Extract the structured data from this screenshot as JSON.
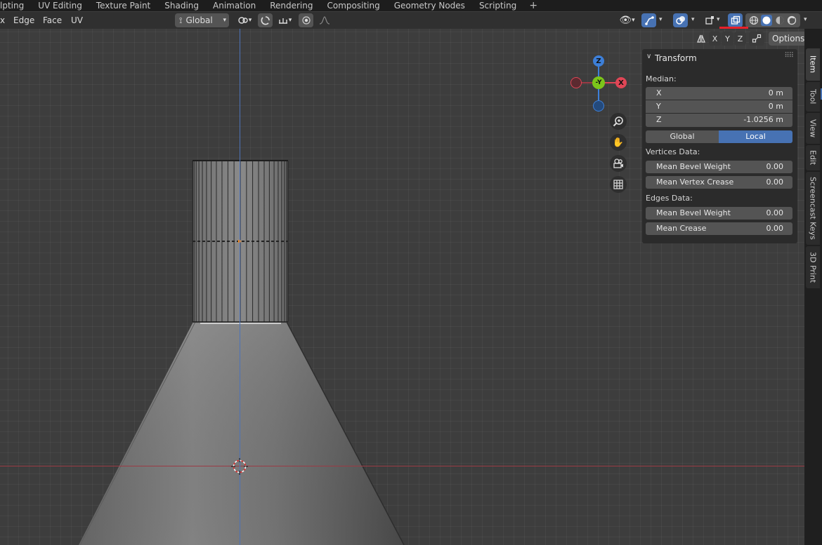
{
  "workspace_tabs": [
    "lpting",
    "UV Editing",
    "Texture Paint",
    "Shading",
    "Animation",
    "Rendering",
    "Compositing",
    "Geometry Nodes",
    "Scripting"
  ],
  "workspace_add": "+",
  "header": {
    "menus": [
      "Edge",
      "Face",
      "UV"
    ],
    "transform_orientation": "Global"
  },
  "axis_toggles": [
    "X",
    "Y",
    "Z"
  ],
  "options_label": "Options",
  "gizmo": {
    "z": "Z",
    "y": "-Y",
    "x": "X"
  },
  "transform_panel": {
    "title": "Transform",
    "median_label": "Median:",
    "fields": [
      {
        "label": "X",
        "value": "0 m"
      },
      {
        "label": "Y",
        "value": "0 m"
      },
      {
        "label": "Z",
        "value": "-1.0256 m"
      }
    ],
    "space_options": [
      "Global",
      "Local"
    ],
    "space_selected": "Local",
    "vertices_label": "Vertices Data:",
    "vertices": [
      {
        "label": "Mean Bevel Weight",
        "value": "0.00"
      },
      {
        "label": "Mean Vertex Crease",
        "value": "0.00"
      }
    ],
    "edges_label": "Edges Data:",
    "edges": [
      {
        "label": "Mean Bevel Weight",
        "value": "0.00"
      },
      {
        "label": "Mean Crease",
        "value": "0.00"
      }
    ]
  },
  "side_tabs": [
    "Item",
    "Tool",
    "View",
    "Edit",
    "Screencast Keys",
    "3D Print"
  ],
  "colors": {
    "accent": "#4772b3",
    "x_axis": "#e04656",
    "y_axis": "#7cc51a",
    "z_axis": "#3d7fd8",
    "highlight": "#e8202a"
  }
}
